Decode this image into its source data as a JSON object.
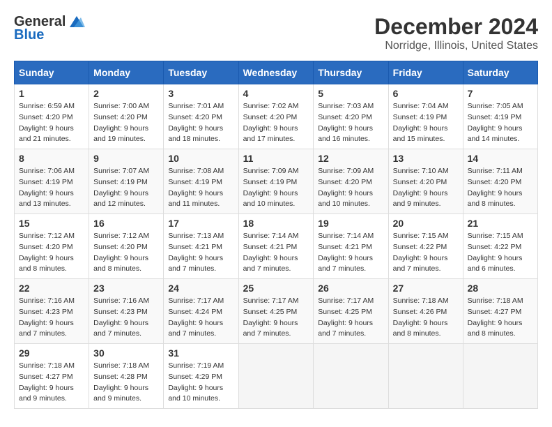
{
  "logo": {
    "general": "General",
    "blue": "Blue"
  },
  "title": {
    "month": "December 2024",
    "location": "Norridge, Illinois, United States"
  },
  "days_of_week": [
    "Sunday",
    "Monday",
    "Tuesday",
    "Wednesday",
    "Thursday",
    "Friday",
    "Saturday"
  ],
  "weeks": [
    [
      {
        "day": "1",
        "sunrise": "6:59 AM",
        "sunset": "4:20 PM",
        "daylight": "9 hours and 21 minutes."
      },
      {
        "day": "2",
        "sunrise": "7:00 AM",
        "sunset": "4:20 PM",
        "daylight": "9 hours and 19 minutes."
      },
      {
        "day": "3",
        "sunrise": "7:01 AM",
        "sunset": "4:20 PM",
        "daylight": "9 hours and 18 minutes."
      },
      {
        "day": "4",
        "sunrise": "7:02 AM",
        "sunset": "4:20 PM",
        "daylight": "9 hours and 17 minutes."
      },
      {
        "day": "5",
        "sunrise": "7:03 AM",
        "sunset": "4:20 PM",
        "daylight": "9 hours and 16 minutes."
      },
      {
        "day": "6",
        "sunrise": "7:04 AM",
        "sunset": "4:19 PM",
        "daylight": "9 hours and 15 minutes."
      },
      {
        "day": "7",
        "sunrise": "7:05 AM",
        "sunset": "4:19 PM",
        "daylight": "9 hours and 14 minutes."
      }
    ],
    [
      {
        "day": "8",
        "sunrise": "7:06 AM",
        "sunset": "4:19 PM",
        "daylight": "9 hours and 13 minutes."
      },
      {
        "day": "9",
        "sunrise": "7:07 AM",
        "sunset": "4:19 PM",
        "daylight": "9 hours and 12 minutes."
      },
      {
        "day": "10",
        "sunrise": "7:08 AM",
        "sunset": "4:19 PM",
        "daylight": "9 hours and 11 minutes."
      },
      {
        "day": "11",
        "sunrise": "7:09 AM",
        "sunset": "4:19 PM",
        "daylight": "9 hours and 10 minutes."
      },
      {
        "day": "12",
        "sunrise": "7:09 AM",
        "sunset": "4:20 PM",
        "daylight": "9 hours and 10 minutes."
      },
      {
        "day": "13",
        "sunrise": "7:10 AM",
        "sunset": "4:20 PM",
        "daylight": "9 hours and 9 minutes."
      },
      {
        "day": "14",
        "sunrise": "7:11 AM",
        "sunset": "4:20 PM",
        "daylight": "9 hours and 8 minutes."
      }
    ],
    [
      {
        "day": "15",
        "sunrise": "7:12 AM",
        "sunset": "4:20 PM",
        "daylight": "9 hours and 8 minutes."
      },
      {
        "day": "16",
        "sunrise": "7:12 AM",
        "sunset": "4:20 PM",
        "daylight": "9 hours and 8 minutes."
      },
      {
        "day": "17",
        "sunrise": "7:13 AM",
        "sunset": "4:21 PM",
        "daylight": "9 hours and 7 minutes."
      },
      {
        "day": "18",
        "sunrise": "7:14 AM",
        "sunset": "4:21 PM",
        "daylight": "9 hours and 7 minutes."
      },
      {
        "day": "19",
        "sunrise": "7:14 AM",
        "sunset": "4:21 PM",
        "daylight": "9 hours and 7 minutes."
      },
      {
        "day": "20",
        "sunrise": "7:15 AM",
        "sunset": "4:22 PM",
        "daylight": "9 hours and 7 minutes."
      },
      {
        "day": "21",
        "sunrise": "7:15 AM",
        "sunset": "4:22 PM",
        "daylight": "9 hours and 6 minutes."
      }
    ],
    [
      {
        "day": "22",
        "sunrise": "7:16 AM",
        "sunset": "4:23 PM",
        "daylight": "9 hours and 7 minutes."
      },
      {
        "day": "23",
        "sunrise": "7:16 AM",
        "sunset": "4:23 PM",
        "daylight": "9 hours and 7 minutes."
      },
      {
        "day": "24",
        "sunrise": "7:17 AM",
        "sunset": "4:24 PM",
        "daylight": "9 hours and 7 minutes."
      },
      {
        "day": "25",
        "sunrise": "7:17 AM",
        "sunset": "4:25 PM",
        "daylight": "9 hours and 7 minutes."
      },
      {
        "day": "26",
        "sunrise": "7:17 AM",
        "sunset": "4:25 PM",
        "daylight": "9 hours and 7 minutes."
      },
      {
        "day": "27",
        "sunrise": "7:18 AM",
        "sunset": "4:26 PM",
        "daylight": "9 hours and 8 minutes."
      },
      {
        "day": "28",
        "sunrise": "7:18 AM",
        "sunset": "4:27 PM",
        "daylight": "9 hours and 8 minutes."
      }
    ],
    [
      {
        "day": "29",
        "sunrise": "7:18 AM",
        "sunset": "4:27 PM",
        "daylight": "9 hours and 9 minutes."
      },
      {
        "day": "30",
        "sunrise": "7:18 AM",
        "sunset": "4:28 PM",
        "daylight": "9 hours and 9 minutes."
      },
      {
        "day": "31",
        "sunrise": "7:19 AM",
        "sunset": "4:29 PM",
        "daylight": "9 hours and 10 minutes."
      },
      null,
      null,
      null,
      null
    ]
  ],
  "labels": {
    "sunrise": "Sunrise:",
    "sunset": "Sunset:",
    "daylight": "Daylight:"
  }
}
